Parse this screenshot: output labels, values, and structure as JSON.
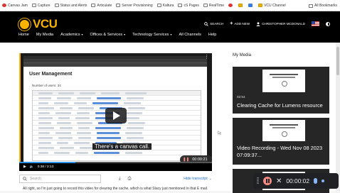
{
  "bookmarks_bar": {
    "items": [
      "Canvas Jam",
      "Capture",
      "Status and Alerts",
      "Articulate",
      "Server Provisioning",
      "Kaltura",
      "cS Pages",
      "RealTime",
      "",
      "",
      "",
      "VCU Channel"
    ],
    "all_bookmarks": "All Bookmarks"
  },
  "header": {
    "logo_text": "VCU",
    "actions": {
      "search": "SEARCH",
      "add_new": "ADD NEW",
      "user": "CHRISTOPHER MCDONALD"
    },
    "nav": [
      "Home",
      "My Media",
      "Academics",
      "Offices & Services",
      "Technology Services",
      "All Channels",
      "Help"
    ]
  },
  "player": {
    "inner_page": {
      "title": "User Management",
      "count_label": "Number of users: 34"
    },
    "caption": "There's a canvas call.",
    "time": "0:38 / 2:13",
    "mini_recorder_time": "00:00:21",
    "progress_fraction": 0.29
  },
  "transcript_bar": {
    "search_placeholder": "Search",
    "hide_label": "Hide transcript",
    "text": "All right, so I'm just going to record this video for clearing the cache, which is what Stacy just mentioned in that E mail. It's"
  },
  "sidebar": {
    "title": "My Media",
    "items": [
      {
        "duration": "02:54",
        "title": "Clearing Cache for Lumens resource"
      },
      {
        "title_line1": "Video Recording - Wed Nov 08 2023",
        "title_line2": "07:09:37..."
      }
    ]
  },
  "recorder": {
    "time": "00:00:02"
  }
}
